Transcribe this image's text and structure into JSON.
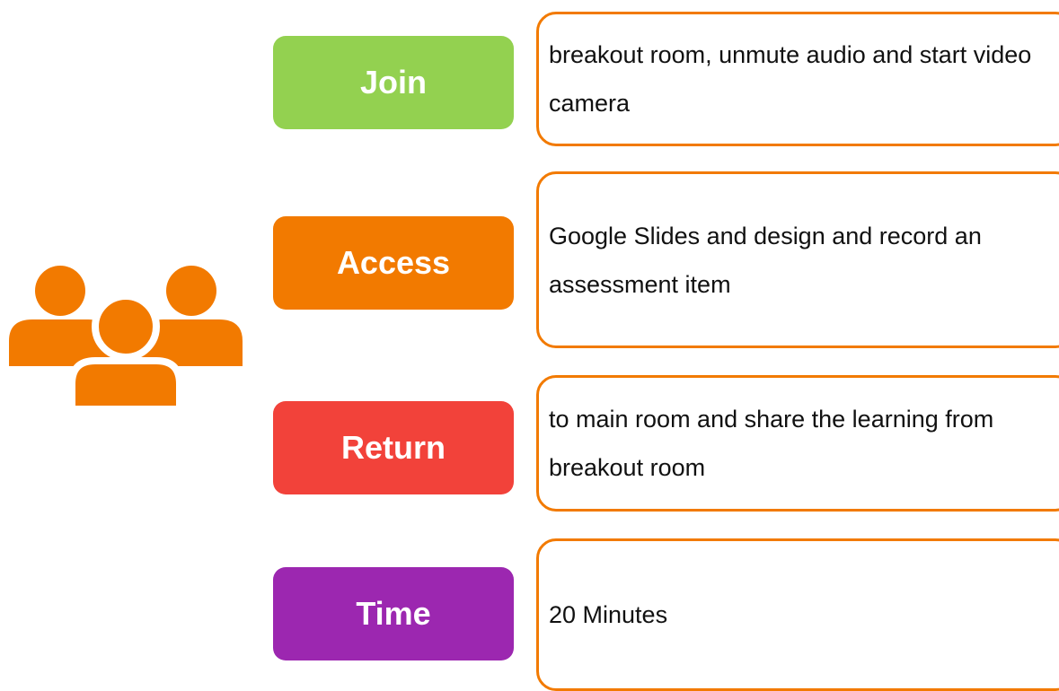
{
  "icon": "group-of-people-icon",
  "colors": {
    "icon": "#f27a00",
    "box_border": "#f27a00"
  },
  "steps": [
    {
      "label": "Join",
      "color": "#93d150",
      "description": "breakout room, unmute audio and start video camera"
    },
    {
      "label": "Access",
      "color": "#f27a00",
      "description": "Google Slides and design and record an assessment item"
    },
    {
      "label": "Return",
      "color": "#f2423a",
      "description": "to main room and share the learning from breakout room"
    },
    {
      "label": "Time",
      "color": "#9c27b0",
      "description": "20 Minutes"
    }
  ]
}
